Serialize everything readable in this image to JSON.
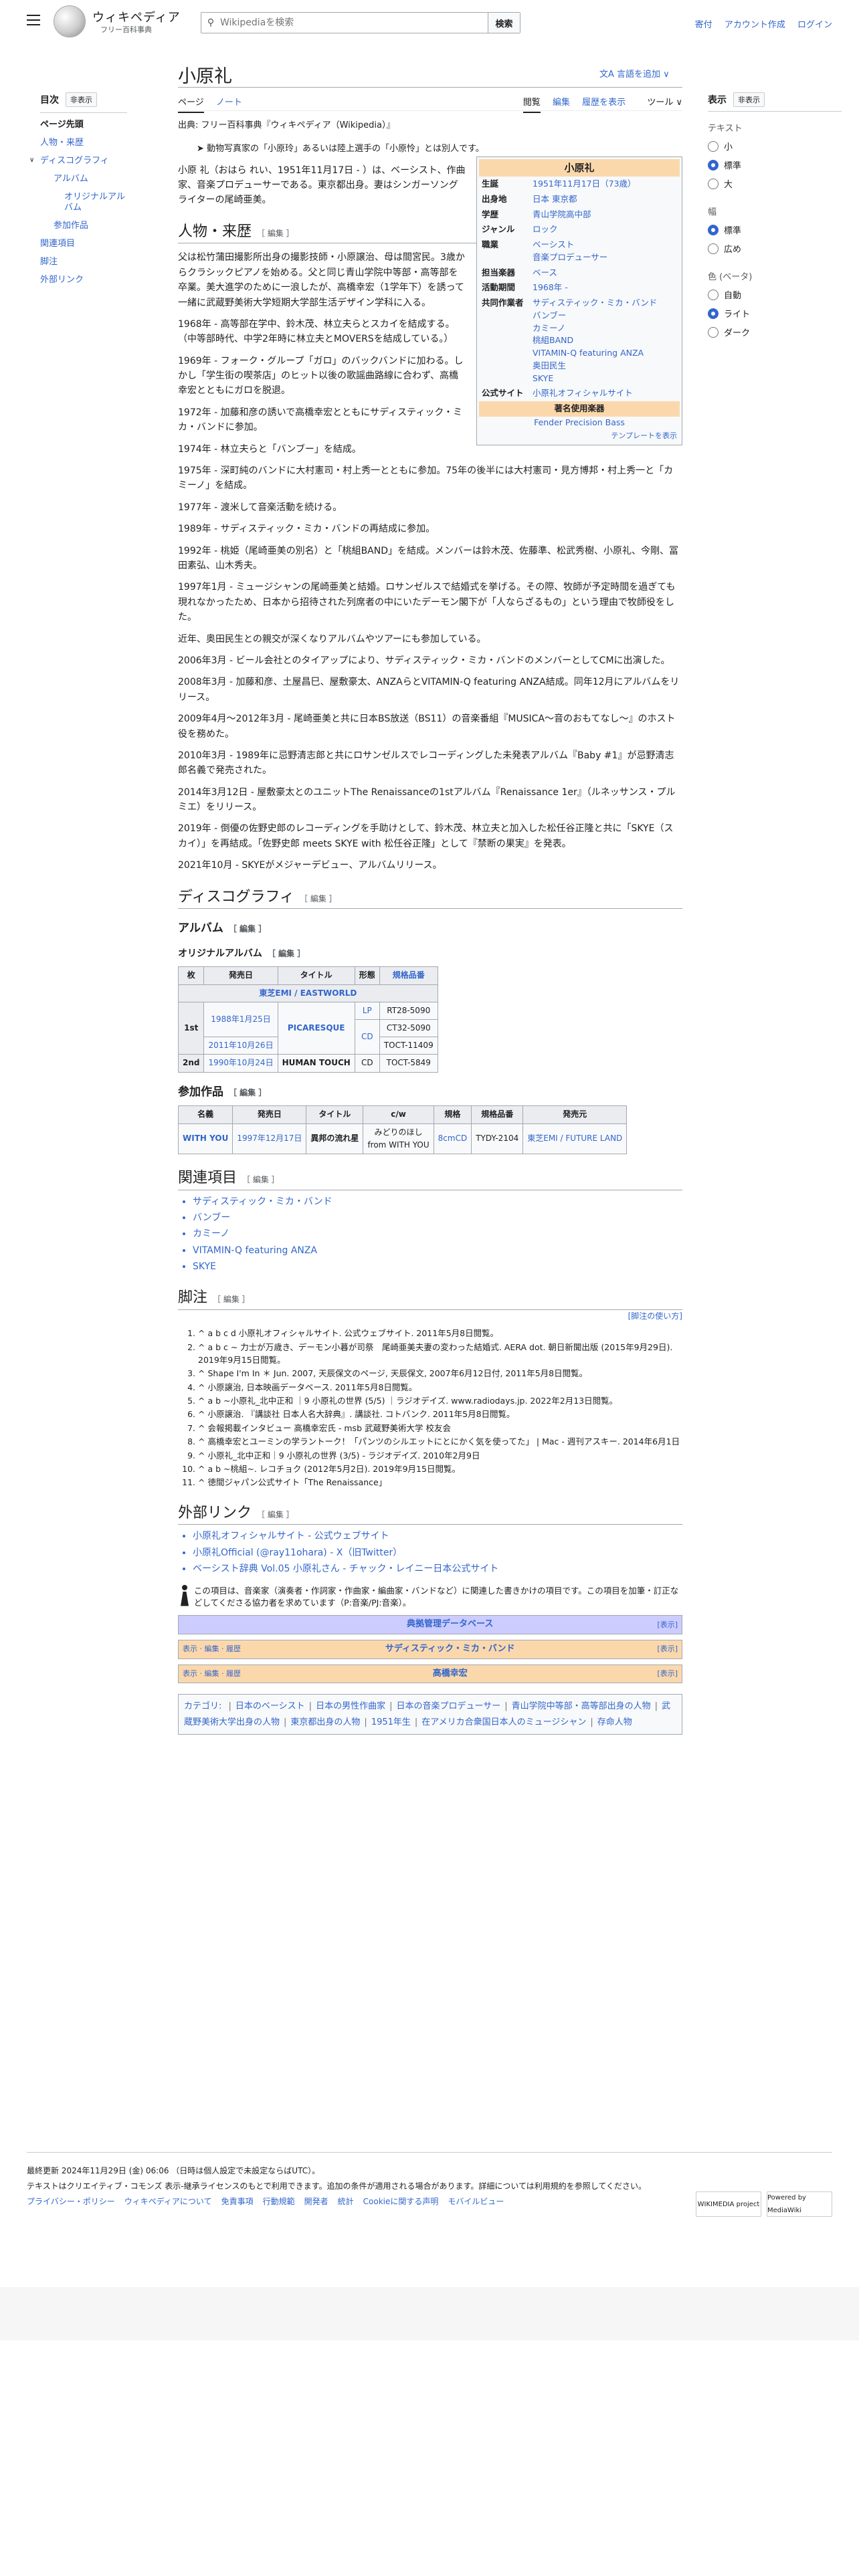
{
  "header": {
    "logo_title": "ウィキペディア",
    "logo_subtitle": "フリー百科事典",
    "search_placeholder": "Wikipediaを検索",
    "search_button": "検索",
    "user_links": [
      "寄付",
      "アカウント作成",
      "ログイン"
    ]
  },
  "toc": {
    "title": "目次",
    "hide": "非表示",
    "items": [
      {
        "label": "ページ先頭",
        "level": 0,
        "bold": true
      },
      {
        "label": "人物・来歴",
        "level": 0
      },
      {
        "label": "ディスコグラフィ",
        "level": 0
      },
      {
        "label": "アルバム",
        "level": 1
      },
      {
        "label": "オリジナルアルバム",
        "level": 2
      },
      {
        "label": "参加作品",
        "level": 1
      },
      {
        "label": "関連項目",
        "level": 0
      },
      {
        "label": "脚注",
        "level": 0
      },
      {
        "label": "外部リンク",
        "level": 0
      }
    ]
  },
  "page": {
    "title": "小原礼",
    "lang_button": "言語を追加",
    "tabs_left": [
      "ページ",
      "ノート"
    ],
    "tabs_right": [
      "閲覧",
      "編集",
      "履歴を表示",
      "ツール"
    ],
    "from": "出典: フリー百科事典『ウィキペディア（Wikipedia）』",
    "hatnote": "動物写真家の「小原玲」あるいは陸上選手の「小原怜」とは別人です。"
  },
  "tools": {
    "title": "表示",
    "hide": "非表示",
    "text_label": "テキスト",
    "text_opts": [
      "小",
      "標準",
      "大"
    ],
    "width_label": "幅",
    "width_opts": [
      "標準",
      "広め"
    ],
    "color_label": "色 (ベータ)",
    "color_opts": [
      "自動",
      "ライト",
      "ダーク"
    ]
  },
  "infobox": {
    "title": "小原礼",
    "rows": [
      {
        "k": "生誕",
        "v": "1951年11月17日（73歳）"
      },
      {
        "k": "出身地",
        "v": "日本 東京都"
      },
      {
        "k": "学歴",
        "v": "青山学院高中部"
      },
      {
        "k": "ジャンル",
        "v": "ロック"
      },
      {
        "k": "職業",
        "v": "ベーシスト\n音楽プロデューサー"
      },
      {
        "k": "担当楽器",
        "v": "ベース"
      },
      {
        "k": "活動期間",
        "v": "1968年 -"
      },
      {
        "k": "共同作業者",
        "v": "サディスティック・ミカ・バンド\nバンブー\nカミーノ\n桃組BAND\nVITAMIN-Q featuring ANZA\n奥田民生\nSKYE"
      },
      {
        "k": "公式サイト",
        "v": "小原礼オフィシャルサイト"
      }
    ],
    "band": "著名使用楽器",
    "instrument": "Fender Precision Bass",
    "template": "テンプレートを表示"
  },
  "sections": {
    "bio": "人物・来歴",
    "disco": "ディスコグラフィ",
    "album": "アルバム",
    "orig": "オリジナルアルバム",
    "part": "参加作品",
    "related": "関連項目",
    "notes": "脚注",
    "ext": "外部リンク",
    "edit": "［ 編集 ］"
  },
  "lead": "小原 礼（おはら れい、1951年11月17日 - ）は、ベーシスト、作曲家、音楽プロデューサーである。東京都出身。妻はシンガーソングライターの尾崎亜美。",
  "bio_paras": [
    "父は松竹蒲田撮影所出身の撮影技師・小原譲治、母は間宮民。3歳からクラシックピアノを始める。父と同じ青山学院中等部・高等部を卒業。美大進学のために一浪したが、高橋幸宏（1学年下）を誘って一緒に武蔵野美術大学短期大学部生活デザイン学科に入る。",
    "1968年 - 高等部在学中、鈴木茂、林立夫らとスカイを結成する。（中等部時代、中学2年時に林立夫とMOVERSを結成している。）",
    "1969年 - フォーク・グループ「ガロ」のバックバンドに加わる。しかし「学生街の喫茶店」のヒット以後の歌謡曲路線に合わず、高橋幸宏とともにガロを脱退。",
    "1972年 - 加藤和彦の誘いで高橋幸宏とともにサディスティック・ミカ・バンドに参加。",
    "1974年 - 林立夫らと「バンブー」を結成。",
    "1975年 - 深町純のバンドに大村憲司・村上秀一とともに参加。75年の後半には大村憲司・見方博邦・村上秀一と「カミーノ」を結成。",
    "1977年 - 渡米して音楽活動を続ける。",
    "1989年 - サディスティック・ミカ・バンドの再結成に参加。",
    "1992年 - 桃姫（尾崎亜美の別名）と「桃組BAND」を結成。メンバーは鈴木茂、佐藤準、松武秀樹、小原礼、今剛、冨田素弘、山木秀夫。",
    "1997年1月 - ミュージシャンの尾崎亜美と結婚。ロサンゼルスで結婚式を挙げる。その際、牧師が予定時間を過ぎても現れなかったため、日本から招待された列席者の中にいたデーモン閣下が「人ならざるもの」という理由で牧師役をした。",
    "近年、奥田民生との親交が深くなりアルバムやツアーにも参加している。",
    "2006年3月 - ビール会社とのタイアップにより、サディスティック・ミカ・バンドのメンバーとしてCMに出演した。",
    "2008年3月 - 加藤和彦、土屋昌巳、屋敷豪太、ANZAらとVITAMIN-Q featuring ANZA結成。同年12月にアルバムをリリース。",
    "2009年4月～2012年3月 - 尾崎亜美と共に日本BS放送（BS11）の音楽番組『MUSICA〜音のおもてなし〜』のホスト役を務めた。",
    "2010年3月 - 1989年に忌野清志郎と共にロサンゼルスでレコーディングした未発表アルバム『Baby #1』が忌野清志郎名義で発売された。",
    "2014年3月12日 - 屋敷豪太とのユニットThe Renaissanceの1stアルバム『Renaissance 1er』（ルネッサンス・プルミエ）をリリース。",
    "2019年 - 倒優の佐野史郎のレコーディングを手助けとして、鈴木茂、林立夫と加入した松任谷正隆と共に「SKYE（スカイ）」を再結成。「佐野史郎 meets SKYE with 松任谷正隆」として『禁断の果実』を発表。",
    "2021年10月 - SKYEがメジャーデビュー、アルバムリリース。"
  ],
  "orig_table": {
    "headers": [
      "枚",
      "発売日",
      "タイトル",
      "形態",
      "規格品番"
    ],
    "label_row": "東芝EMI / EASTWORLD",
    "rows": [
      {
        "no": "1st",
        "date": "1988年1月25日",
        "title": "PICARESQUE",
        "fmt": "LP",
        "cat": "RT28-5090"
      },
      {
        "no": "",
        "date": "",
        "title": "",
        "fmt": "CD",
        "cat": "CT32-5090"
      },
      {
        "no": "",
        "date": "2011年10月26日",
        "title": "",
        "fmt": "",
        "cat": "TOCT-11409"
      },
      {
        "no": "2nd",
        "date": "1990年10月24日",
        "title": "HUMAN TOUCH",
        "fmt": "CD",
        "cat": "TOCT-5849"
      }
    ]
  },
  "part_table": {
    "headers": [
      "名義",
      "発売日",
      "タイトル",
      "c/w",
      "規格",
      "規格品番",
      "発売元"
    ],
    "rows": [
      {
        "a": "WITH YOU",
        "b": "1997年12月17日",
        "c": "異邦の流れ星",
        "d": "みどりのほし\nfrom WITH YOU",
        "e": "8cmCD",
        "f": "TYDY-2104",
        "g": "東芝EMI / FUTURE LAND"
      }
    ]
  },
  "related": [
    "サディスティック・ミカ・バンド",
    "バンブー",
    "カミーノ",
    "VITAMIN-Q featuring ANZA",
    "SKYE"
  ],
  "notes_help": "[脚注の使い方]",
  "refs": [
    "^ a b c d 小原礼オフィシャルサイト. 公式ウェブサイト. 2011年5月8日閲覧。",
    "^ a b c ~ 力士が万歳き、デーモン小暮が司祭　尾崎亜美夫妻の変わった結婚式. AERA dot. 朝日新聞出版 (2015年9月29日). 2019年9月15日閲覧。",
    "^ Shape I'm In ＊ Jun. 2007, 天辰保文のページ, 天辰保文, 2007年6月12日付, 2011年5月8日閲覧。",
    "^ 小原譲治, 日本映画データベース. 2011年5月8日閲覧。",
    "^ a b ~小原礼_北中正和 ｜9 小原礼の世界 (5/5) ｜ラジオデイズ. www.radiodays.jp. 2022年2月13日閲覧。",
    "^ 小原譲治. 『講談社 日本人名大辞典』. 講談社. コトバンク. 2011年5月8日閲覧。",
    "^ 会報掲載インタビュー 高橋幸宏氏 - msb 武蔵野美術大学 校友会",
    "^ 高橋幸宏とユーミンの学ラントーク！「パンツのシルエットにとにかく気を使ってた」 | Mac - 週刊アスキー. 2014年6月1日",
    "^ 小原礼_北中正和｜9 小原礼の世界 (3/5) - ラジオデイズ. 2010年2月9日",
    "^ a b ~桃組~. レコチョク (2012年5月2日). 2019年9月15日閲覧。",
    "^ 徳間ジャパン公式サイト「The Renaissance」"
  ],
  "ext_links": [
    "小原礼オフィシャルサイト - 公式ウェブサイト",
    "小原礼Official (@ray11ohara) - X（旧Twitter）",
    "ベーシスト辞典 Vol.05 小原礼さん - チャック・レイニー日本公式サイト"
  ],
  "stub": "この項目は、音楽家（演奏者・作詞家・作曲家・編曲家・バンドなど）に関連した書きかけの項目です。この項目を加筆・訂正などしてくださる協力者を求めています（P:音楽/PJ:音楽）。",
  "navboxes": [
    {
      "title": "典拠管理データベース",
      "show": "[表示]",
      "left": ""
    },
    {
      "title": "サディスティック・ミカ・バンド",
      "show": "[表示]",
      "left": "表示 · 編集 · 履歴"
    },
    {
      "title": "高橋幸宏",
      "show": "[表示]",
      "left": "表示 · 編集 · 履歴"
    }
  ],
  "categories": {
    "label": "カテゴリ:",
    "items": [
      "日本のベーシスト",
      "日本の男性作曲家",
      "日本の音楽プロデューサー",
      "青山学院中等部・高等部出身の人物",
      "武蔵野美術大学出身の人物",
      "東京都出身の人物",
      "1951年生",
      "在アメリカ合衆国日本人のミュージシャン",
      "存命人物"
    ]
  },
  "footer": {
    "updated": "最終更新 2024年11月29日 (金) 06:06 （日時は個人設定で未設定ならばUTC）。",
    "license": "テキストはクリエイティブ・コモンズ 表示-継承ライセンスのもとで利用できます。追加の条件が適用される場合があります。詳細については利用規約を参照してください。",
    "links": [
      "プライバシー・ポリシー",
      "ウィキペディアについて",
      "免責事項",
      "行動規範",
      "開発者",
      "統計",
      "Cookieに関する声明",
      "モバイルビュー"
    ],
    "badge1": "WIKIMEDIA project",
    "badge2": "Powered by MediaWiki"
  },
  "colors": {
    "link": "#3366cc",
    "redlink": "#d73333",
    "infobox_header": "#fbd8ac",
    "navbox": "#ccccff"
  }
}
